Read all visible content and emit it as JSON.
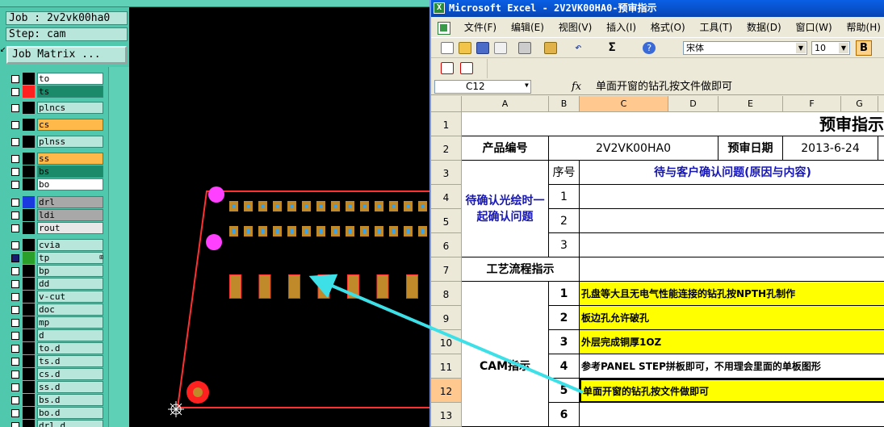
{
  "cam": {
    "job_label": "Job : 2v2vk00ha0",
    "step_label": "Step: cam",
    "job_matrix_button": "Job Matrix ...",
    "layers": [
      {
        "name": "to",
        "color": "#ffffff",
        "swatch": "#000000",
        "checked": false
      },
      {
        "name": "ts",
        "color": "#1a8a6a",
        "swatch": "#ff2020",
        "checked": false
      },
      {
        "name": "plncs",
        "color": "#b8e6db",
        "swatch": "#000000",
        "checked": false
      },
      {
        "name": "cs",
        "color": "#ffb84a",
        "swatch": "#000000",
        "checked": false
      },
      {
        "name": "plnss",
        "color": "#b8e6db",
        "swatch": "#000000",
        "checked": false
      },
      {
        "name": "ss",
        "color": "#ffb84a",
        "swatch": "#000000",
        "checked": false
      },
      {
        "name": "bs",
        "color": "#1a8a6a",
        "swatch": "#000000",
        "checked": false
      },
      {
        "name": "bo",
        "color": "#ffffff",
        "swatch": "#000000",
        "checked": false
      },
      {
        "name": "drl",
        "color": "#a8a8a8",
        "swatch": "#1a3ae0",
        "checked": false
      },
      {
        "name": "ldi",
        "color": "#a8a8a8",
        "swatch": "#000000",
        "checked": false
      },
      {
        "name": "rout",
        "color": "#e8e8e8",
        "swatch": "#000000",
        "checked": false
      },
      {
        "name": "cvia",
        "color": "#b8e6db",
        "swatch": "#000000",
        "checked": false
      },
      {
        "name": "tp",
        "color": "#b8e6db",
        "swatch": "#2aa02a",
        "checked": true
      },
      {
        "name": "bp",
        "color": "#b8e6db",
        "swatch": "#000000",
        "checked": false
      },
      {
        "name": "dd",
        "color": "#b8e6db",
        "swatch": "#000000",
        "checked": false
      },
      {
        "name": "v-cut",
        "color": "#b8e6db",
        "swatch": "#000000",
        "checked": false
      },
      {
        "name": "doc",
        "color": "#b8e6db",
        "swatch": "#000000",
        "checked": false
      },
      {
        "name": "mp",
        "color": "#b8e6db",
        "swatch": "#000000",
        "checked": false
      },
      {
        "name": "d",
        "color": "#b8e6db",
        "swatch": "#000000",
        "checked": false
      },
      {
        "name": "to.d",
        "color": "#b8e6db",
        "swatch": "#000000",
        "checked": false
      },
      {
        "name": "ts.d",
        "color": "#b8e6db",
        "swatch": "#000000",
        "checked": false
      },
      {
        "name": "cs.d",
        "color": "#b8e6db",
        "swatch": "#000000",
        "checked": false
      },
      {
        "name": "ss.d",
        "color": "#b8e6db",
        "swatch": "#000000",
        "checked": false
      },
      {
        "name": "bs.d",
        "color": "#b8e6db",
        "swatch": "#000000",
        "checked": false
      },
      {
        "name": "bo.d",
        "color": "#b8e6db",
        "swatch": "#000000",
        "checked": false
      },
      {
        "name": "drl.d",
        "color": "#b8e6db",
        "swatch": "#000000",
        "checked": false
      }
    ],
    "colors": {
      "board_outline": "#ff3030",
      "pad": "#c08a2a",
      "via": "#40a0e0",
      "fiducial": "#ff40ff",
      "annotation_arrow": "#3ee0e8"
    }
  },
  "excel": {
    "title": "Microsoft Excel - 2V2VK00HA0-预审指示",
    "menu": [
      "文件(F)",
      "编辑(E)",
      "视图(V)",
      "插入(I)",
      "格式(O)",
      "工具(T)",
      "数据(D)",
      "窗口(W)",
      "帮助(H)"
    ],
    "font_name": "宋体",
    "font_size": "10",
    "bold_label": "B",
    "name_box": "C12",
    "fx_label": "fx",
    "formula": "单面开窗的钻孔按文件做即可",
    "columns": [
      "A",
      "B",
      "C",
      "D",
      "E",
      "F",
      "G"
    ],
    "rows": [
      "1",
      "2",
      "3",
      "4",
      "5",
      "6",
      "7",
      "8",
      "9",
      "10",
      "11",
      "12",
      "13"
    ],
    "sheet": {
      "title": "预审指示",
      "product_no_label": "产品编号",
      "product_no": "2V2VK00HA0",
      "review_date_label": "预审日期",
      "review_date": "2013-6-24",
      "pending_label": "待确认光绘时一起确认问题",
      "seq_label": "序号",
      "issue_header": "待与客户确认问题(原因与内容)",
      "pending_numbers": [
        "1",
        "2",
        "3"
      ],
      "process_label": "工艺流程指示",
      "cam_label": "CAM指示",
      "cam_items": [
        {
          "no": "1",
          "text": "孔盘等大且无电气性能连接的钻孔按NPTH孔制作"
        },
        {
          "no": "2",
          "text": "板边孔允许破孔"
        },
        {
          "no": "3",
          "text": "外层完成铜厚1OZ"
        },
        {
          "no": "4",
          "text": "参考PANEL STEP拼板即可，不用理会里面的单板图形"
        },
        {
          "no": "5",
          "text": "单面开窗的钻孔按文件做即可"
        },
        {
          "no": "6",
          "text": ""
        }
      ]
    }
  }
}
